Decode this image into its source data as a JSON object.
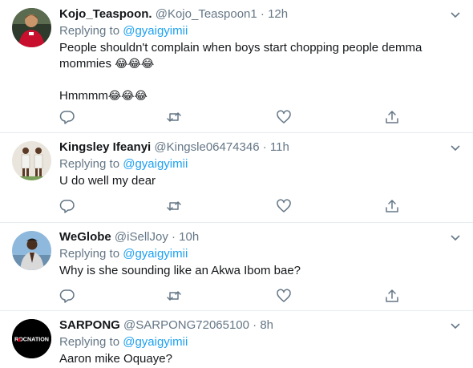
{
  "tweets": [
    {
      "name": "Kojo_Teaspoon.",
      "handle": "@Kojo_Teaspoon1",
      "time": "12h",
      "replying_label": "Replying to",
      "mention": "@gyaigyimii",
      "text": "People shouldn't complain when boys start chopping people demma mommies",
      "text_emoji": "😂😂😂",
      "text2": "Hmmmm",
      "text2_emoji": "😂😂😂"
    },
    {
      "name": "Kingsley Ifeanyi",
      "handle": "@Kingsle06474346",
      "time": "11h",
      "replying_label": "Replying to",
      "mention": "@gyaigyimii",
      "text": "U do well my dear"
    },
    {
      "name": "WeGlobe",
      "handle": "@iSellJoy",
      "time": "10h",
      "replying_label": "Replying to",
      "mention": "@gyaigyimii",
      "text": "Why is she sounding like an Akwa Ibom bae?"
    },
    {
      "name": "SARPONG",
      "handle": "@SARPONG72065100",
      "time": "8h",
      "replying_label": "Replying to",
      "mention": "@gyaigyimii",
      "text": "Aaron mike Oquaye?",
      "avatar_text": "ROCNATION"
    }
  ],
  "separator": "·",
  "icons": [
    "reply-icon",
    "retweet-icon",
    "like-icon",
    "share-icon",
    "chevron-down-icon"
  ],
  "colors": {
    "link": "#1da1f2",
    "muted": "#657786",
    "divider": "#e6ecf0"
  }
}
